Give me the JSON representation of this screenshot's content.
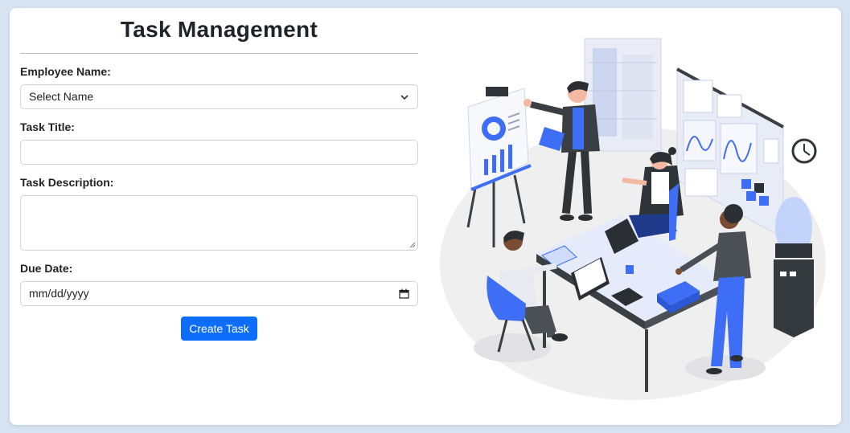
{
  "form": {
    "title": "Task Management",
    "employee_label": "Employee Name:",
    "employee_value": "Select Name",
    "task_title_label": "Task Title:",
    "task_title_value": "",
    "task_desc_label": "Task Description:",
    "task_desc_value": "",
    "due_date_label": "Due Date:",
    "due_date_placeholder": "mm/dd/yyyy",
    "submit_label": "Create Task"
  },
  "colors": {
    "accent": "#0d6efd",
    "illustration_blue": "#3d6ef5",
    "background": "#d6e3f3"
  },
  "icons": {
    "select": "chevron-down-icon",
    "date": "calendar-icon",
    "textarea": "resize-grip-icon"
  }
}
